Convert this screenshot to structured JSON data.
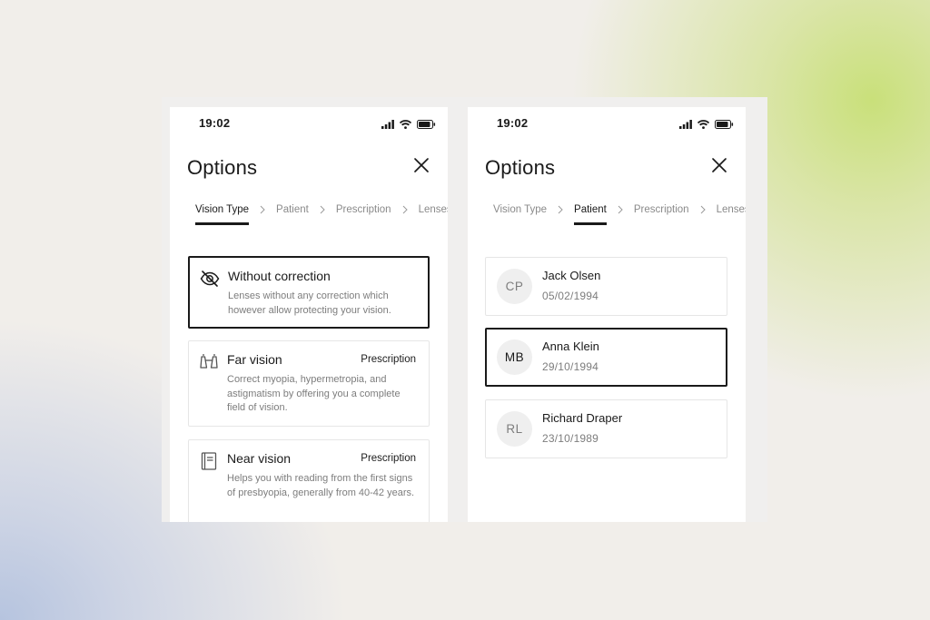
{
  "screens": [
    {
      "status": {
        "time": "19:02",
        "icons": [
          "signal-icon",
          "wifi-icon",
          "battery-icon"
        ]
      },
      "title": "Options",
      "close_icon": "close-icon",
      "steps": [
        "Vision Type",
        "Patient",
        "Prescription",
        "Lenses"
      ],
      "active_step": "Vision Type",
      "vision_options": [
        {
          "icon": "eye-slash-icon",
          "title": "Without correction",
          "tag": "",
          "description": "Lenses without any correction which however allow protecting your vision.",
          "selected": true
        },
        {
          "icon": "binoculars-icon",
          "title": "Far vision",
          "tag": "Prescription",
          "description": "Correct myopia, hypermetropia, and astigmatism by offering you a complete field  of vision.",
          "selected": false
        },
        {
          "icon": "book-icon",
          "title": "Near vision",
          "tag": "Prescription",
          "description": "Helps you with reading from the first signs of presbyopia, generally from 40-42 years.",
          "selected": false
        }
      ]
    },
    {
      "status": {
        "time": "19:02",
        "icons": [
          "signal-icon",
          "wifi-icon",
          "battery-icon"
        ]
      },
      "title": "Options",
      "close_icon": "close-icon",
      "steps": [
        "Vision Type",
        "Patient",
        "Prescription",
        "Lenses"
      ],
      "active_step": "Patient",
      "patients": [
        {
          "initials": "CP",
          "name": "Jack Olsen",
          "date": "05/02/1994",
          "selected": false
        },
        {
          "initials": "MB",
          "name": "Anna Klein",
          "date": "29/10/1994",
          "selected": true
        },
        {
          "initials": "RL",
          "name": "Richard Draper",
          "date": "23/10/1989",
          "selected": false
        }
      ]
    }
  ],
  "colors": {
    "text_primary": "#1a1a1a",
    "text_secondary": "#7d7d7d",
    "card_border": "#e6e6e6",
    "avatar_bg": "#efefef",
    "bg_green_glow": "#c9e07a",
    "bg_blue_glow": "#b6c4df"
  }
}
